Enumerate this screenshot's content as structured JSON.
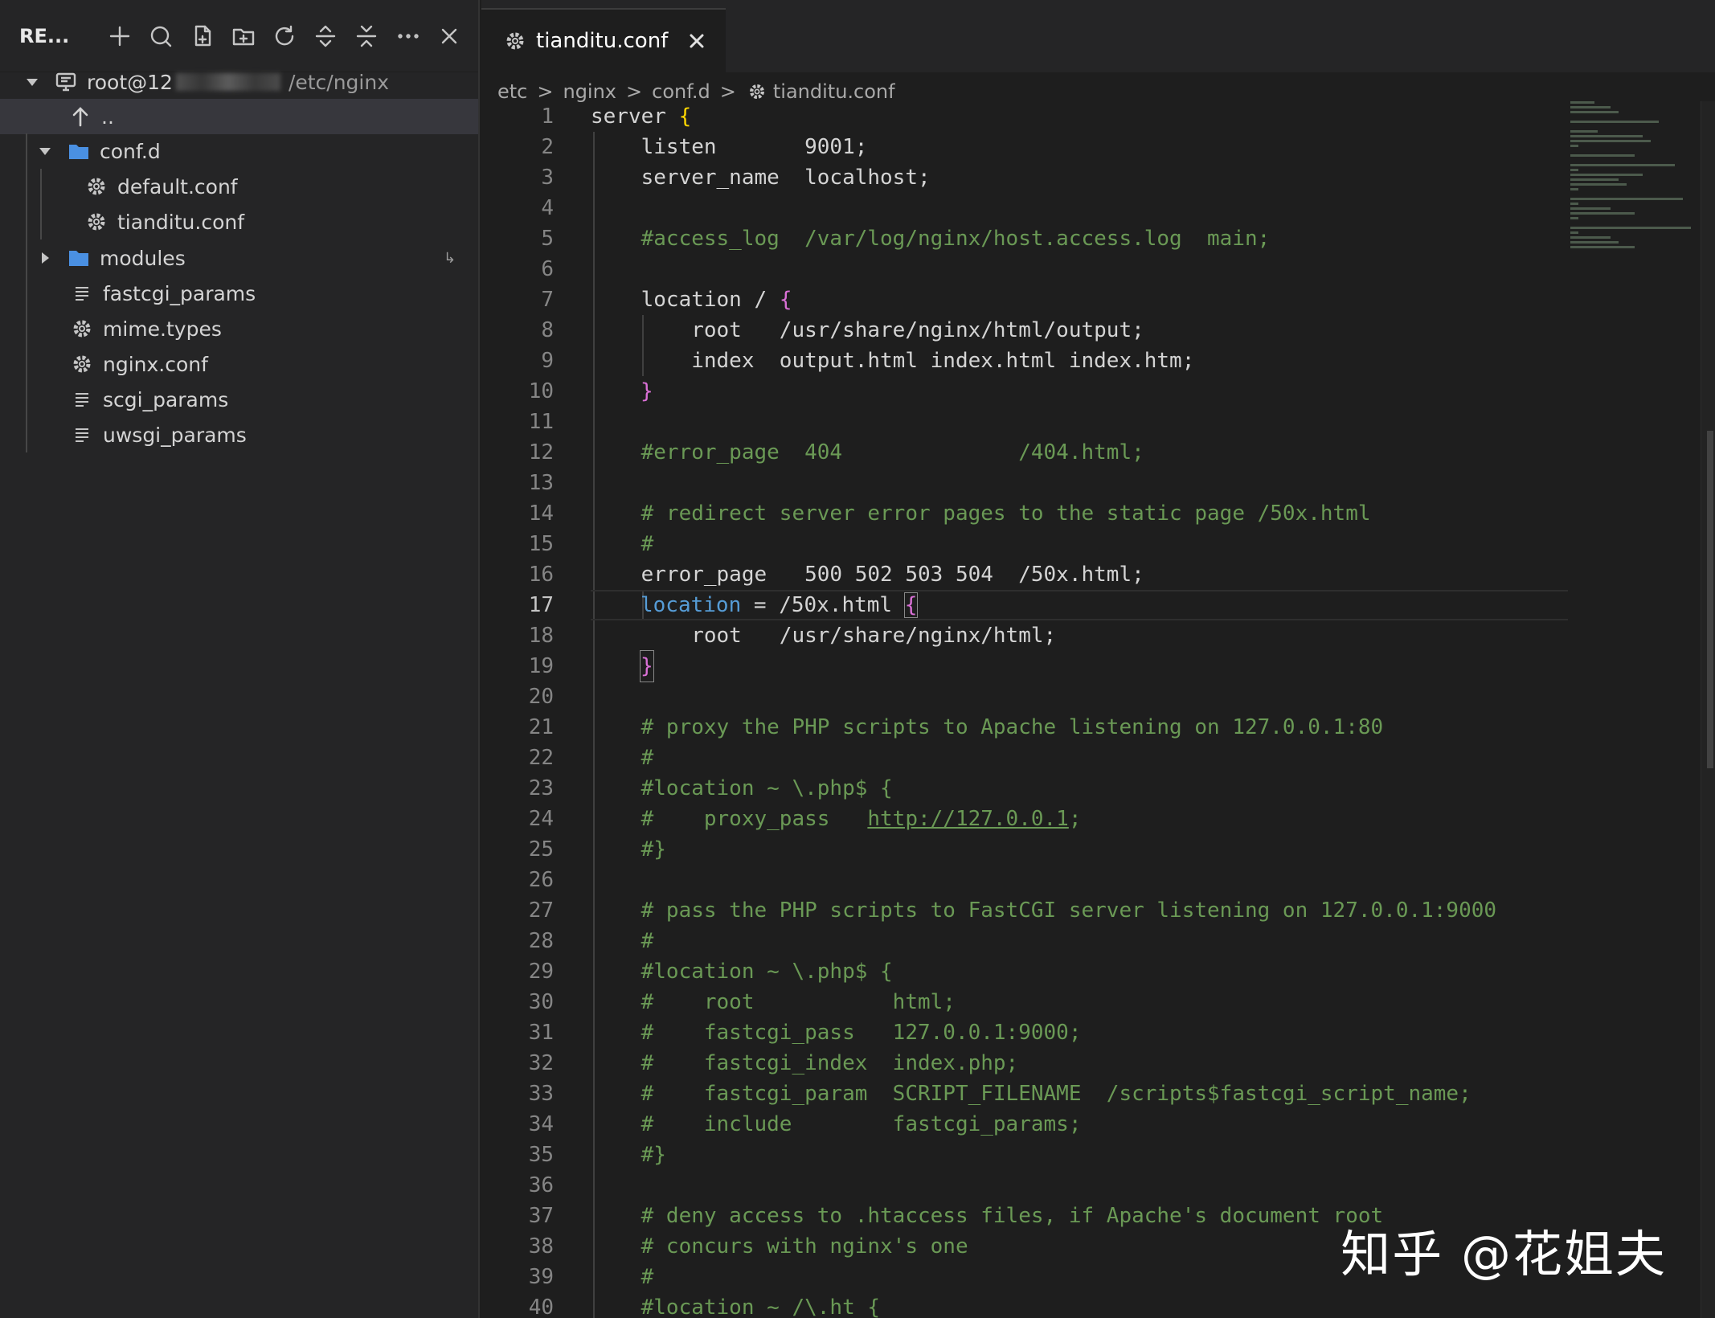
{
  "sidebar": {
    "title": "RE...",
    "toolbar_icons": [
      "plus-icon",
      "search-icon",
      "new-file-icon",
      "new-folder-icon",
      "refresh-icon",
      "collapse-icon",
      "expand-icon",
      "more-icon",
      "close-icon"
    ],
    "root": {
      "label": "root@12",
      "path": "/etc/nginx"
    },
    "parent_label": "..",
    "items": [
      {
        "label": "conf.d",
        "type": "folder",
        "expanded": true
      },
      {
        "label": "default.conf",
        "type": "gear"
      },
      {
        "label": "tianditu.conf",
        "type": "gear"
      },
      {
        "label": "modules",
        "type": "folder",
        "expanded": false
      },
      {
        "label": "fastcgi_params",
        "type": "text"
      },
      {
        "label": "mime.types",
        "type": "gear"
      },
      {
        "label": "nginx.conf",
        "type": "gear"
      },
      {
        "label": "scgi_params",
        "type": "text"
      },
      {
        "label": "uwsgi_params",
        "type": "text"
      }
    ]
  },
  "editor": {
    "tab": {
      "label": "tianditu.conf"
    },
    "breadcrumb": [
      "etc",
      "nginx",
      "conf.d",
      "tianditu.conf"
    ],
    "active_line": 17,
    "lines": [
      "1",
      "2",
      "3",
      "4",
      "5",
      "6",
      "7",
      "8",
      "9",
      "10",
      "11",
      "12",
      "13",
      "14",
      "15",
      "16",
      "17",
      "18",
      "19",
      "20",
      "21",
      "22",
      "23",
      "24",
      "25",
      "26",
      "27",
      "28",
      "29",
      "30",
      "31",
      "32",
      "33",
      "34",
      "35",
      "36",
      "37",
      "38",
      "39",
      "40"
    ],
    "code": {
      "l1a": "server ",
      "l1b": "{",
      "l2": "    listen       9001;",
      "l3": "    server_name  localhost;",
      "l5": "    #access_log  /var/log/nginx/host.access.log  main;",
      "l7a": "    location / ",
      "l7b": "{",
      "l8": "        root   /usr/share/nginx/html/output;",
      "l9": "        index  output.html index.html index.htm;",
      "l10": "}",
      "l12": "    #error_page  404              /404.html;",
      "l14": "    # redirect server error pages to the static page /50x.html",
      "l15": "    #",
      "l16": "    error_page   500 502 503 504  /50x.html;",
      "l17a": "location",
      "l17b": " = /50x.html ",
      "l17c": "{",
      "l18": "        root   /usr/share/nginx/html;",
      "l19": "}",
      "l21": "    # proxy the PHP scripts to Apache listening on 127.0.0.1:80",
      "l22": "    #",
      "l23": "    #location ~ \\.php$ {",
      "l24a": "    #    proxy_pass   ",
      "l24b": "http://127.0.0.1",
      "l24c": ";",
      "l25": "    #}",
      "l27": "    # pass the PHP scripts to FastCGI server listening on 127.0.0.1:9000",
      "l28": "    #",
      "l29": "    #location ~ \\.php$ {",
      "l30": "    #    root           html;",
      "l31": "    #    fastcgi_pass   127.0.0.1:9000;",
      "l32": "    #    fastcgi_index  index.php;",
      "l33": "    #    fastcgi_param  SCRIPT_FILENAME  /scripts$fastcgi_script_name;",
      "l34": "    #    include        fastcgi_params;",
      "l35": "    #}",
      "l37": "    # deny access to .htaccess files, if Apache's document root",
      "l38": "    # concurs with nginx's one",
      "l39": "    #",
      "l40": "    #location ~ /\\.ht {"
    }
  },
  "watermark": "知乎 @花姐夫",
  "colors": {
    "comment": "#6a9955",
    "keyword": "#569cd6",
    "bracket_gold": "#ffd700",
    "bracket_purple": "#da70d6",
    "folder": "#4a90e2"
  }
}
